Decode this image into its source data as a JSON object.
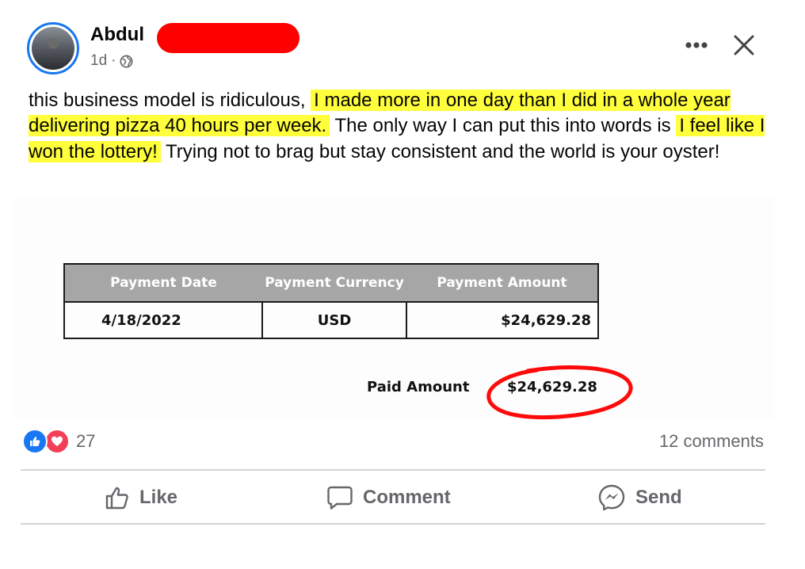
{
  "post": {
    "author": "Abdul",
    "time": "1d",
    "time_separator": "·",
    "text_segments": [
      {
        "text": "this business model is ridiculous, ",
        "highlight": false
      },
      {
        "text": "I made more in one day than I did in a whole year delivering pizza 40 hours per week.",
        "highlight": true
      },
      {
        "text": " The only way I can put this into words is ",
        "highlight": false
      },
      {
        "text": "I feel like I won the lottery!",
        "highlight": true
      },
      {
        "text": " Trying not to brag but stay consistent and the world is your oyster!",
        "highlight": false
      }
    ]
  },
  "payment": {
    "headers": [
      "Payment Date",
      "Payment Currency",
      "Payment Amount"
    ],
    "row": [
      "4/18/2022",
      "USD",
      "$24,629.28"
    ],
    "paid_label": "Paid Amount",
    "paid_value": "$24,629.28"
  },
  "engagement": {
    "reaction_count": "27",
    "comments": "12 comments"
  },
  "actions": {
    "like": "Like",
    "comment": "Comment",
    "send": "Send"
  },
  "colors": {
    "highlight": "#ffff3c",
    "redaction": "#ff0000",
    "like_blue": "#1877f2",
    "love_red": "#f33e58",
    "secondary_text": "#65676b",
    "table_header": "#a6a6a6"
  },
  "icons": {
    "privacy": "globe-icon",
    "more": "more-options-icon",
    "close": "close-icon",
    "like_reaction": "thumbs-up-icon",
    "love_reaction": "heart-icon",
    "like_action": "thumbs-up-outline-icon",
    "comment_action": "speech-bubble-icon",
    "send_action": "messenger-icon"
  }
}
